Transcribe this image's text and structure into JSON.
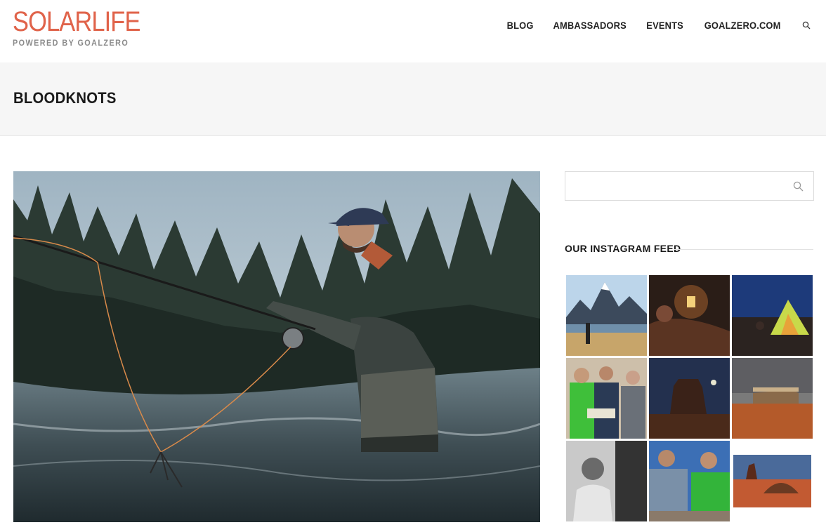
{
  "header": {
    "logo_text": "SOLARLIFE",
    "logo_subtitle": "POWERED BY GOALZERO",
    "nav": [
      {
        "label": "BLOG"
      },
      {
        "label": "AMBASSADORS"
      },
      {
        "label": "EVENTS"
      },
      {
        "label": "GOALZERO.COM"
      }
    ],
    "search_icon": "search-icon"
  },
  "page": {
    "title": "BLOODKNOTS"
  },
  "hero": {
    "subject": "fly-fishing-in-river-photo"
  },
  "sidebar": {
    "search": {
      "value": "",
      "placeholder": ""
    },
    "instagram_title": "OUR INSTAGRAM FEED",
    "instagram_tiles": [
      "mountain-lake-photo",
      "lantern-cave-photo",
      "tent-at-dusk-photo",
      "three-people-map-photo",
      "butte-night-photo",
      "cabin-desert-photo",
      "portrait-bw-photo",
      "two-climbers-photo",
      "hogan-sunset-photo"
    ]
  },
  "colors": {
    "brand": "#e0634a",
    "title_bar_bg": "#f6f6f6",
    "text": "#222222"
  }
}
